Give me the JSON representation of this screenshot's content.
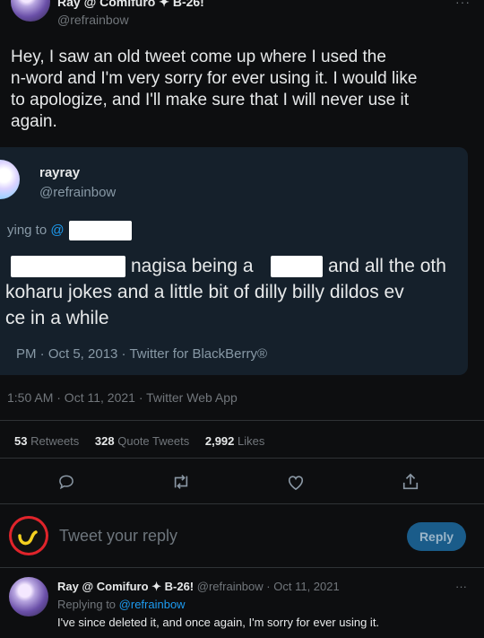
{
  "main_tweet": {
    "display_name": "Ray @ Comifuro ✦ B-26!",
    "handle": "@refrainbow",
    "more": "···",
    "text_lines": [
      "Hey, I saw an old tweet come up where I used the",
      "n-word and I'm very sorry for ever using it. I would like",
      "to apologize, and I'll make sure that I will never use it",
      "again."
    ],
    "timestamp": "1:50 AM · Oct 11, 2021 · Twitter Web App"
  },
  "quoted": {
    "display_name": "rayray",
    "handle": "@refrainbow",
    "replying_prefix": "ying to",
    "replying_at": "@",
    "line1_b": "nagisa being a",
    "line1_c": "and all the oth",
    "line2": "koharu jokes and a little bit of dilly billy dildos ev",
    "line3": "ce in a while",
    "meta": "PM · Oct 5, 2013 · Twitter for BlackBerry®"
  },
  "stats": {
    "retweets_count": "53",
    "retweets_label": "Retweets",
    "quotes_count": "328",
    "quotes_label": "Quote Tweets",
    "likes_count": "2,992",
    "likes_label": "Likes"
  },
  "compose": {
    "placeholder": "Tweet your reply",
    "reply_button": "Reply"
  },
  "reply": {
    "display_name": "Ray @ Comifuro ✦ B-26!",
    "handle": "@refrainbow",
    "date": "· Oct 11, 2021",
    "more": "···",
    "replying_label": "Replying to",
    "replying_to": "@refrainbow",
    "text": "I've since deleted it, and once again, I'm sorry for ever using it."
  }
}
